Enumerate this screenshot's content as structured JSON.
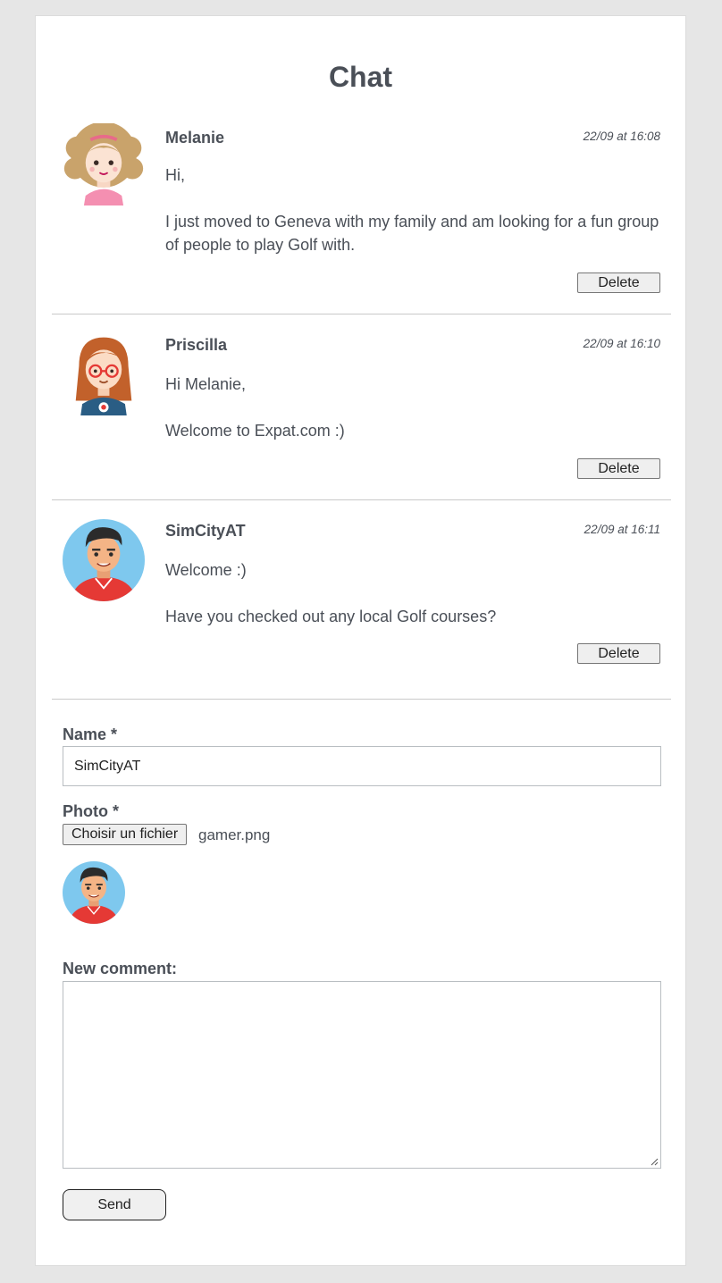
{
  "page": {
    "title": "Chat"
  },
  "posts": [
    {
      "author": "Melanie",
      "timestamp": "22/09 at 16:08",
      "paragraphs": [
        "Hi,",
        "I just moved to Geneva with my family and am looking for a fun group of people to play Golf with."
      ],
      "avatar_icon": "girl-curly-hair-avatar-icon",
      "delete_label": "Delete"
    },
    {
      "author": "Priscilla",
      "timestamp": "22/09 at 16:10",
      "paragraphs": [
        "Hi Melanie,",
        "Welcome to Expat.com :)"
      ],
      "avatar_icon": "girl-glasses-avatar-icon",
      "delete_label": "Delete"
    },
    {
      "author": "SimCityAT",
      "timestamp": "22/09 at 16:11",
      "paragraphs": [
        "Welcome :)",
        "Have you checked out any local Golf courses?"
      ],
      "avatar_icon": "gamer-avatar-icon",
      "delete_label": "Delete"
    }
  ],
  "form": {
    "name_label": "Name *",
    "name_value": "SimCityAT",
    "photo_label": "Photo *",
    "file_button_label": "Choisir un fichier",
    "file_name": "gamer.png",
    "comment_label": "New comment:",
    "comment_value": "",
    "send_label": "Send"
  },
  "colors": {
    "background": "#e6e6e6",
    "card": "#ffffff",
    "text": "#4a4f57",
    "divider": "#c9c9c9"
  }
}
